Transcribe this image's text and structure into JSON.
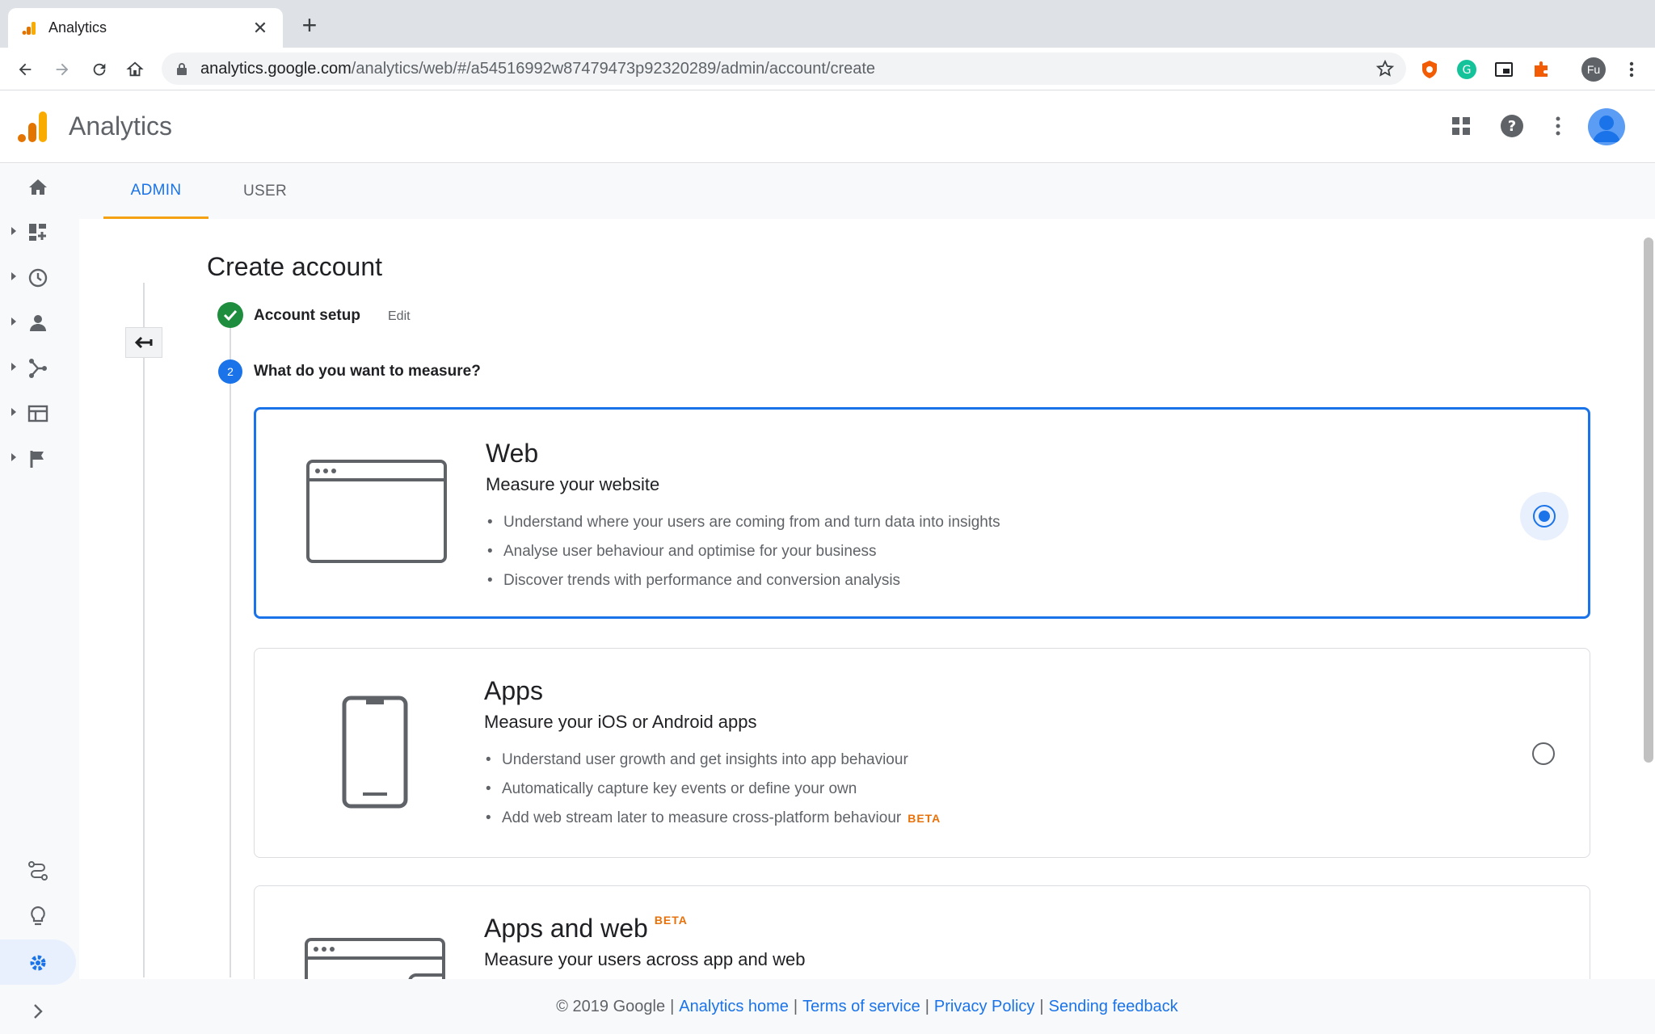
{
  "browser": {
    "tab_title": "Analytics",
    "new_tab_label": "+",
    "url_host": "analytics.google.com",
    "url_path": "/analytics/web/#/a54516992w87479473p92320289/admin/account/create",
    "profile_initials": "Fu"
  },
  "app": {
    "title": "Analytics"
  },
  "tabs": {
    "admin": "ADMIN",
    "user": "USER"
  },
  "page": {
    "title": "Create account",
    "step1_label": "Account setup",
    "step1_edit": "Edit",
    "step2_number": "2",
    "step2_label": "What do you want to measure?"
  },
  "cards": [
    {
      "title": "Web",
      "subtitle": "Measure your website",
      "bullets": [
        "Understand where your users are coming from and turn data into insights",
        "Analyse user behaviour and optimise for your business",
        "Discover trends with performance and conversion analysis"
      ],
      "selected": true
    },
    {
      "title": "Apps",
      "subtitle": "Measure your iOS or Android apps",
      "bullets": [
        "Understand user growth and get insights into app behaviour",
        "Automatically capture key events or define your own",
        "Add web stream later to measure cross-platform behaviour"
      ],
      "bullet_badge": "BETA",
      "selected": false
    },
    {
      "title": "Apps and web",
      "title_badge": "BETA",
      "subtitle": "Measure your users across app and web",
      "selected": false
    }
  ],
  "footer": {
    "copyright": "© 2019 Google",
    "links": [
      "Analytics home",
      "Terms of service",
      "Privacy Policy",
      "Sending feedback"
    ]
  },
  "colors": {
    "accent": "#1a73e8",
    "tab_underline": "#f4a214",
    "beta": "#e8710a",
    "success": "#1e8e3e"
  }
}
